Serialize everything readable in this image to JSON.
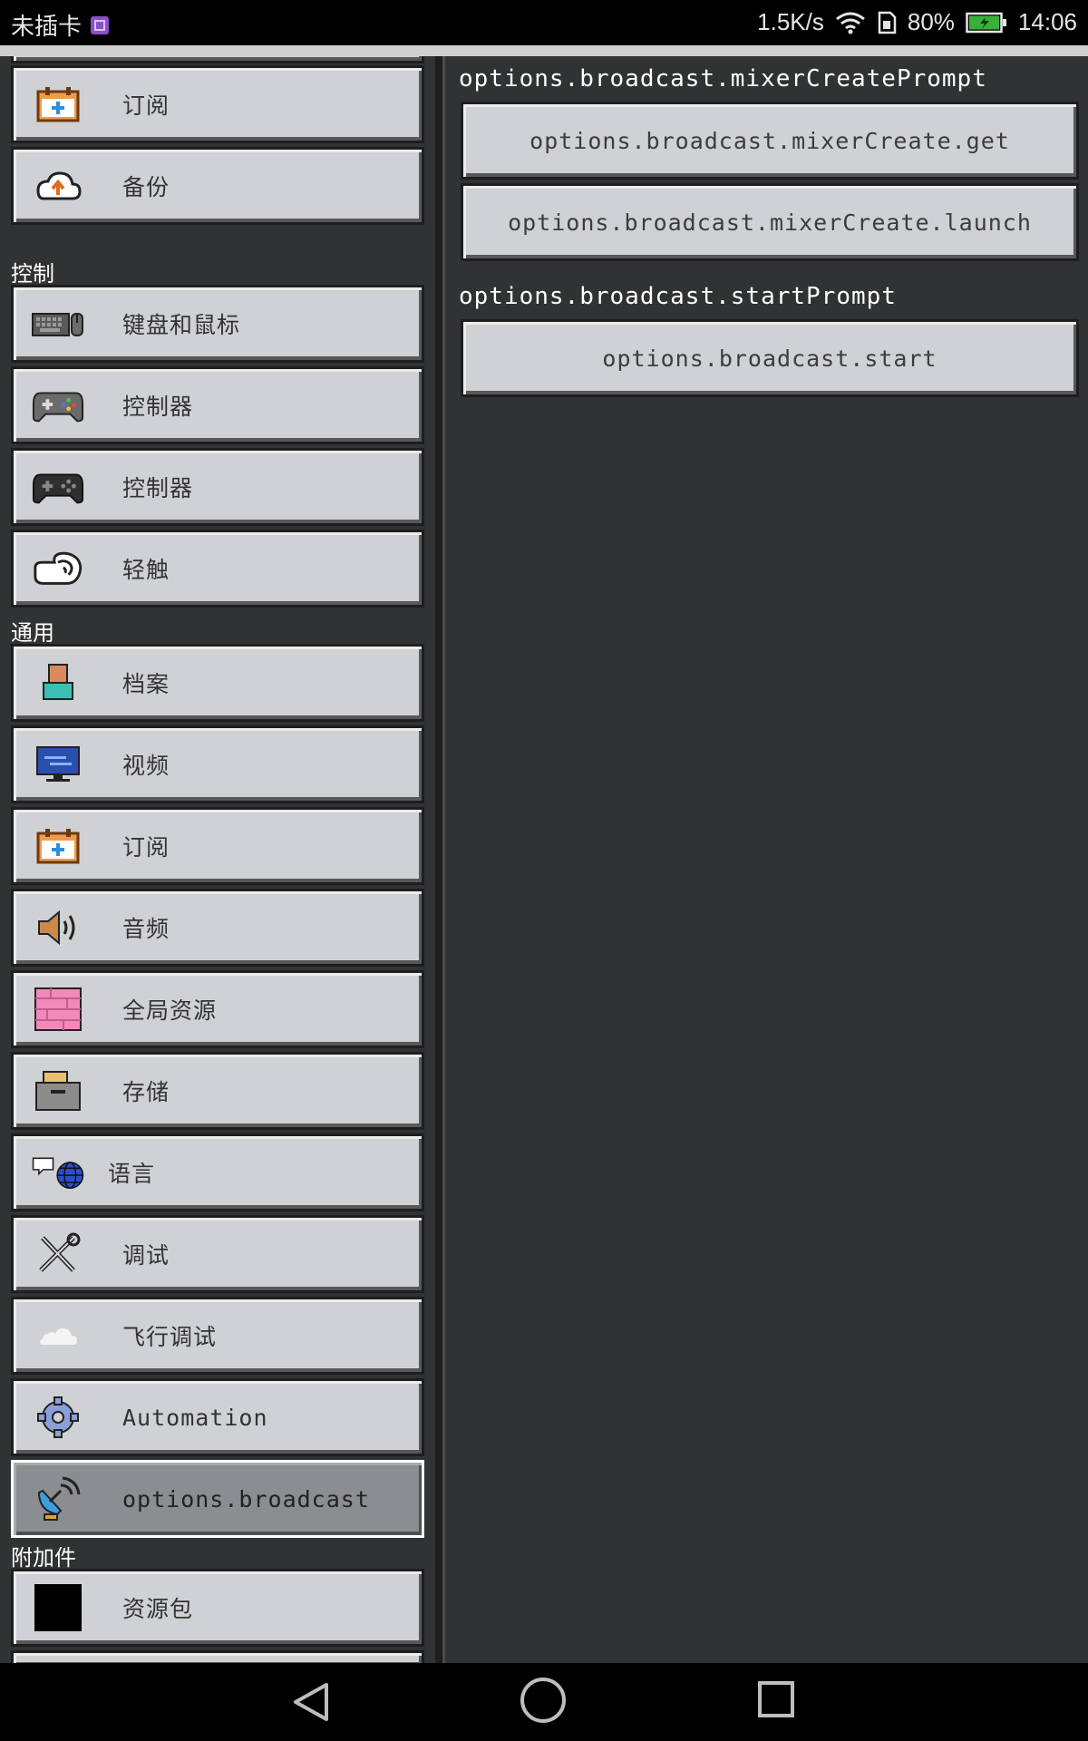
{
  "status_bar": {
    "carrier": "未插卡",
    "speed": "1.5K/s",
    "battery": "80%",
    "time": "14:06"
  },
  "sidebar": {
    "top_items": [
      {
        "label": "订阅",
        "icon": "calendar-plus-icon"
      },
      {
        "label": "备份",
        "icon": "cloud-upload-icon"
      }
    ],
    "sections": [
      {
        "title": "控制",
        "items": [
          {
            "label": "键盘和鼠标",
            "icon": "keyboard-mouse-icon"
          },
          {
            "label": "控制器",
            "icon": "gamepad-icon"
          },
          {
            "label": "控制器",
            "icon": "gamepad-dark-icon"
          },
          {
            "label": "轻触",
            "icon": "touch-hand-icon"
          }
        ]
      },
      {
        "title": "通用",
        "items": [
          {
            "label": "档案",
            "icon": "profile-icon"
          },
          {
            "label": "视频",
            "icon": "monitor-icon"
          },
          {
            "label": "订阅",
            "icon": "calendar-plus-icon"
          },
          {
            "label": "音频",
            "icon": "speaker-icon"
          },
          {
            "label": "全局资源",
            "icon": "pink-texture-icon"
          },
          {
            "label": "存储",
            "icon": "storage-drawer-icon"
          },
          {
            "label": "语言",
            "icon": "language-globe-icon"
          },
          {
            "label": "调试",
            "icon": "tools-icon"
          },
          {
            "label": "飞行调试",
            "icon": "cloud-icon"
          },
          {
            "label": "Automation",
            "icon": "gear-icon"
          },
          {
            "label": "options.broadcast",
            "icon": "satellite-dish-icon",
            "selected": true
          }
        ]
      },
      {
        "title": "附加件",
        "items": [
          {
            "label": "资源包",
            "icon": "black-square-icon"
          }
        ]
      }
    ]
  },
  "panel": {
    "mixer_prompt": "options.broadcast.mixerCreatePrompt",
    "mixer_get_button": "options.broadcast.mixerCreate.get",
    "mixer_launch_button": "options.broadcast.mixerCreate.launch",
    "start_prompt": "options.broadcast.startPrompt",
    "start_button": "options.broadcast.start"
  },
  "colors": {
    "background": "#313233",
    "button": "#d0d1d4",
    "button_selected": "#8c8d90",
    "text_light": "#ffffff"
  }
}
